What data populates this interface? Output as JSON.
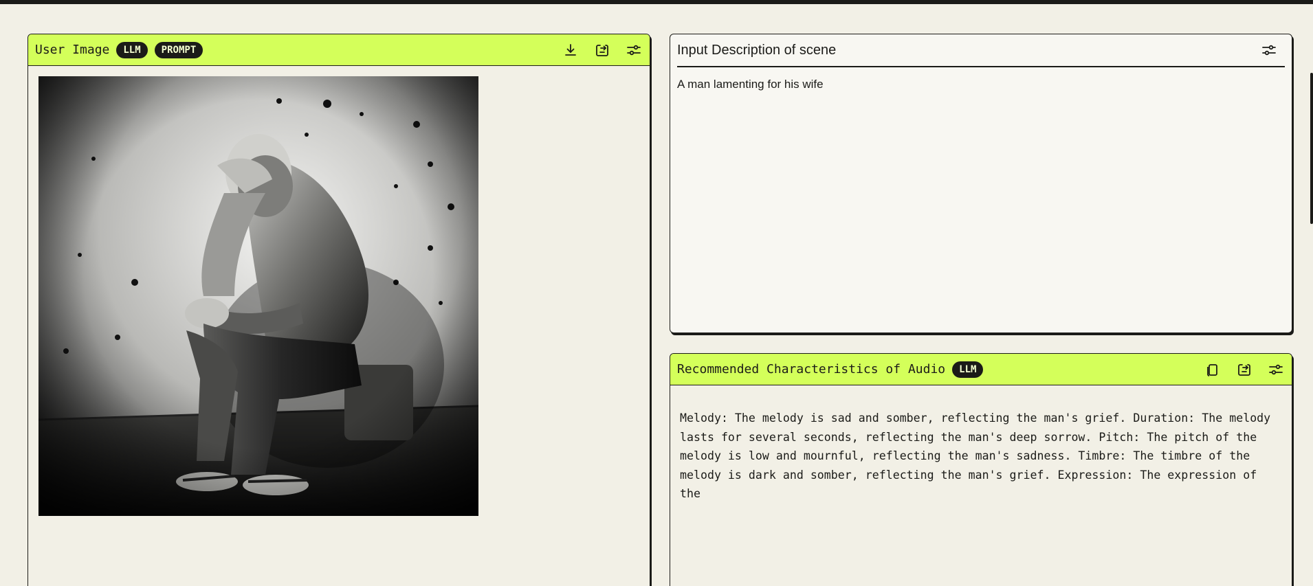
{
  "left_panel": {
    "title": "User Image",
    "badges": [
      "LLM",
      "PROMPT"
    ],
    "icons": [
      "download-icon",
      "share-icon",
      "sliders-icon"
    ]
  },
  "description_panel": {
    "title": "Input Description of scene",
    "text": "A man lamenting for his wife",
    "icons": [
      "sliders-icon"
    ]
  },
  "recommendation_panel": {
    "title": "Recommended Characteristics of Audio",
    "badges": [
      "LLM"
    ],
    "text": "Melody: The melody is sad and somber, reflecting the man's grief. Duration: The melody lasts for several seconds, reflecting the man's deep sorrow. Pitch: The pitch of the melody is low and mournful, reflecting the man's sadness. Timbre: The timbre of the melody is dark and somber, reflecting the man's grief. Expression: The expression of the",
    "icons": [
      "copy-icon",
      "share-icon",
      "sliders-icon"
    ]
  },
  "colors": {
    "accent": "#d4ff5a",
    "background": "#f2f0e6",
    "ink": "#1b1b18"
  }
}
